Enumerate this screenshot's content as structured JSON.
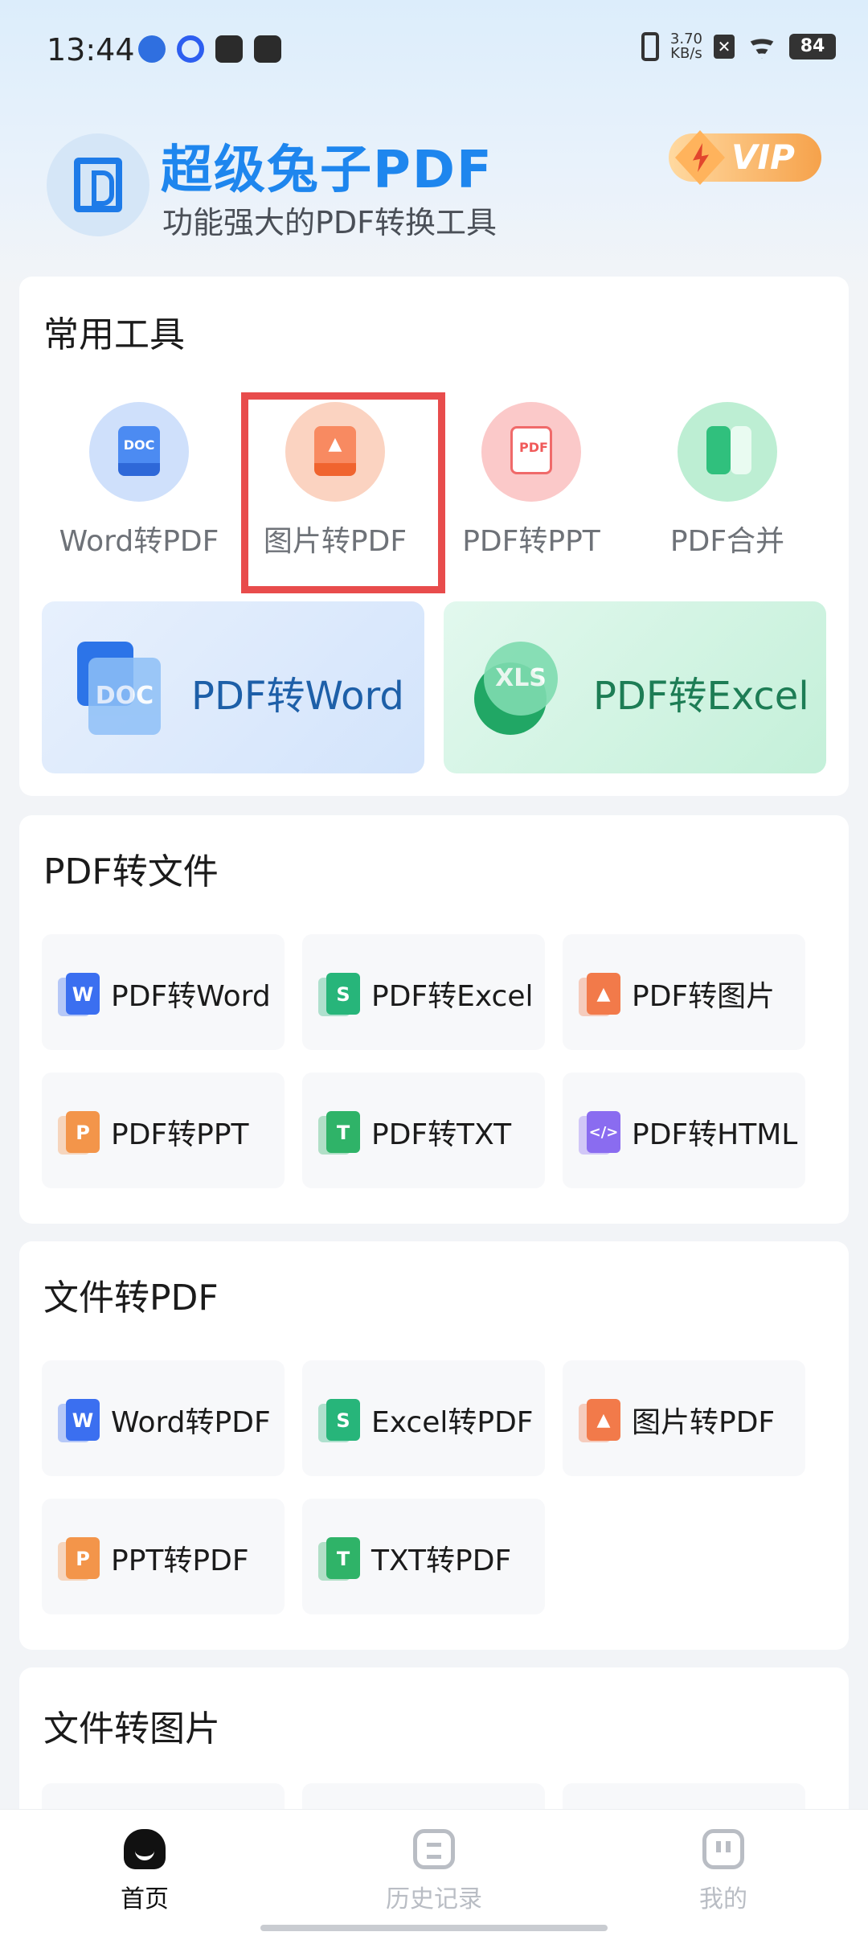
{
  "status_bar": {
    "time": "13:44",
    "net_speed_value": "3.70",
    "net_speed_unit": "KB/s",
    "battery": "84"
  },
  "header": {
    "app_title": "超级兔子PDF",
    "subtitle": "功能强大的PDF转换工具",
    "vip_label": "VIP"
  },
  "common_tools": {
    "title": "常用工具",
    "items": [
      {
        "label": "Word转PDF",
        "icon": "doc-icon",
        "icon_text": "DOC",
        "color": "#3b7ff0"
      },
      {
        "label": "图片转PDF",
        "icon": "image-icon",
        "icon_text": "",
        "color": "#f06a3c"
      },
      {
        "label": "PDF转PPT",
        "icon": "pdf-icon",
        "icon_text": "PDF",
        "color": "#f05a5a"
      },
      {
        "label": "PDF合并",
        "icon": "merge-icon",
        "icon_text": "",
        "color": "#2cbf7a"
      }
    ],
    "featured": [
      {
        "label": "PDF转Word",
        "icon_text": "DOC",
        "color": "#1d5fa8"
      },
      {
        "label": "PDF转Excel",
        "icon_text": "XLS",
        "color": "#1d7d55"
      }
    ]
  },
  "pdf_to_file": {
    "title": "PDF转文件",
    "items": [
      {
        "label": "PDF转Word",
        "letter": "W",
        "color": "#3b6ff0"
      },
      {
        "label": "PDF转Excel",
        "letter": "S",
        "color": "#27b57a"
      },
      {
        "label": "PDF转图片",
        "letter": "",
        "color": "#f27a4a"
      },
      {
        "label": "PDF转PPT",
        "letter": "P",
        "color": "#f3954a"
      },
      {
        "label": "PDF转TXT",
        "letter": "T",
        "color": "#2fb368"
      },
      {
        "label": "PDF转HTML",
        "letter": "</>",
        "color": "#8a6cf0"
      }
    ]
  },
  "file_to_pdf": {
    "title": "文件转PDF",
    "items": [
      {
        "label": "Word转PDF",
        "letter": "W",
        "color": "#3b6ff0"
      },
      {
        "label": "Excel转PDF",
        "letter": "S",
        "color": "#27b57a"
      },
      {
        "label": "图片转PDF",
        "letter": "",
        "color": "#f27a4a"
      },
      {
        "label": "PPT转PDF",
        "letter": "P",
        "color": "#f3954a"
      },
      {
        "label": "TXT转PDF",
        "letter": "T",
        "color": "#2fb368"
      }
    ]
  },
  "file_to_image": {
    "title": "文件转图片"
  },
  "bottom_nav": {
    "items": [
      {
        "label": "首页",
        "active": true
      },
      {
        "label": "历史记录",
        "active": false
      },
      {
        "label": "我的",
        "active": false
      }
    ]
  }
}
